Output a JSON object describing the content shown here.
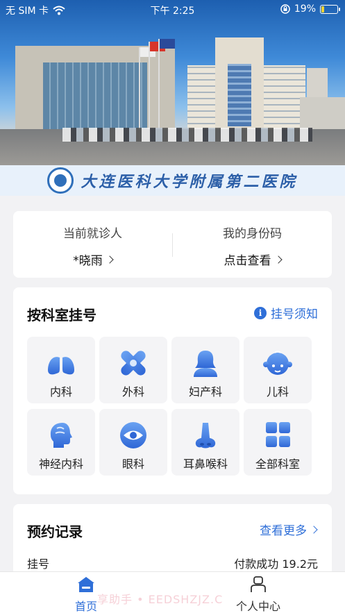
{
  "status_bar": {
    "carrier": "无 SIM 卡",
    "time": "下午 2:25",
    "battery": "19%",
    "battery_level": 0.19,
    "icons": [
      "wifi-icon",
      "orientation-lock-icon",
      "battery-charging-icon"
    ]
  },
  "hero": {
    "image": "hospital-building-photo",
    "hospital_name": "大连医科大学附属第二医院"
  },
  "patient_card": {
    "current_patient_label": "当前就诊人",
    "current_patient_value": "*晓雨",
    "id_code_label": "我的身份码",
    "id_code_value": "点击查看"
  },
  "departments": {
    "title": "按科室挂号",
    "notice_label": "挂号须知",
    "items": [
      {
        "label": "内科",
        "icon": "lungs-icon"
      },
      {
        "label": "外科",
        "icon": "bandage-icon"
      },
      {
        "label": "妇产科",
        "icon": "woman-icon"
      },
      {
        "label": "儿科",
        "icon": "baby-icon"
      },
      {
        "label": "神经内科",
        "icon": "head-brain-icon"
      },
      {
        "label": "眼科",
        "icon": "eye-icon"
      },
      {
        "label": "耳鼻喉科",
        "icon": "nose-icon"
      },
      {
        "label": "全部科室",
        "icon": "grid-icon"
      }
    ]
  },
  "appointments": {
    "title": "预约记录",
    "more_label": "查看更多",
    "rows": [
      {
        "type": "挂号",
        "status": "付款成功 19.2元"
      }
    ]
  },
  "tab_bar": {
    "tabs": [
      {
        "label": "首页",
        "icon": "home-icon",
        "active": true
      },
      {
        "label": "个人中心",
        "icon": "person-icon",
        "active": false
      }
    ]
  },
  "watermark": "享助手 • EEDSHZJZ.C",
  "colors": {
    "accent": "#2f6fd8",
    "icon_gradient_start": "#6aa2f2",
    "icon_gradient_end": "#2f67d6",
    "background": "#f2f2f4"
  }
}
